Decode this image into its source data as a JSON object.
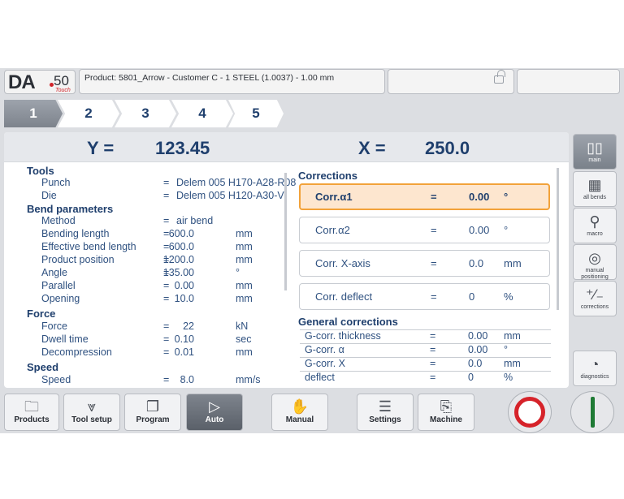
{
  "header": {
    "logo_da": "DA",
    "logo_model": "50",
    "logo_touch": "Touch",
    "product": "Product: 5801_Arrow - Customer C - 1 STEEL (1.0037) - 1.00 mm"
  },
  "steps": [
    "1",
    "2",
    "3",
    "4",
    "5"
  ],
  "axes": {
    "y_label": "Y =",
    "y_value": "123.45",
    "x_label": "X =",
    "x_value": "250.0"
  },
  "lines": [
    {
      "sec": "Tools"
    },
    {
      "label": "Punch",
      "eq": "=",
      "val": "Delem 005 H170-A28-R08"
    },
    {
      "label": "Die",
      "eq": "=",
      "val": "Delem 005 H120-A30-V"
    },
    {
      "sec": "Bend parameters"
    },
    {
      "label": "Method",
      "eq": "=",
      "val": "air bend"
    },
    {
      "label": "Bending length",
      "eq": "=",
      "val": "600.0",
      "unit": "mm"
    },
    {
      "label": "Effective bend length",
      "eq": "=",
      "val": "600.0",
      "unit": "mm"
    },
    {
      "label": "Product position",
      "eq": "=",
      "val": "1200.0",
      "unit": "mm"
    },
    {
      "label": "Angle",
      "eq": "=",
      "val": "135.00",
      "unit": "°"
    },
    {
      "label": "Parallel",
      "eq": "=",
      "val": "0.00",
      "unit": "mm"
    },
    {
      "label": "Opening",
      "eq": "=",
      "val": "10.0",
      "unit": "mm"
    },
    {
      "sec": "Force"
    },
    {
      "label": "Force",
      "eq": "=",
      "val": "22",
      "unit": "kN"
    },
    {
      "label": "Dwell time",
      "eq": "=",
      "val": "0.10",
      "unit": "sec"
    },
    {
      "label": "Decompression",
      "eq": "=",
      "val": "0.01",
      "unit": "mm"
    },
    {
      "sec": "Speed"
    },
    {
      "label": "Speed",
      "eq": "=",
      "val": "8.0",
      "unit": "mm/s"
    }
  ],
  "corrections": {
    "title": "Corrections",
    "items": [
      {
        "label": "Corr.α1",
        "eq": "=",
        "val": "0.00",
        "unit": "°"
      },
      {
        "label": "Corr.α2",
        "eq": "=",
        "val": "0.00",
        "unit": "°"
      },
      {
        "label": "Corr. X-axis",
        "eq": "=",
        "val": "0.0",
        "unit": "mm"
      },
      {
        "label": "Corr. deflect",
        "eq": "=",
        "val": "0",
        "unit": "%"
      }
    ]
  },
  "general": {
    "title": "General corrections",
    "items": [
      {
        "label": "G-corr. thickness",
        "eq": "=",
        "val": "0.00",
        "unit": "mm"
      },
      {
        "label": "G-corr. α",
        "eq": "=",
        "val": "0.00",
        "unit": "°"
      },
      {
        "label": "G-corr. X",
        "eq": "=",
        "val": "0.0",
        "unit": "mm"
      },
      {
        "label": "deflect",
        "eq": "=",
        "val": "0",
        "unit": "%"
      }
    ]
  },
  "side": {
    "main": "main",
    "all_bends": "all bends",
    "macro": "macro",
    "manual_positioning": "manual positioning",
    "corrections": "corrections",
    "diagnostics": "diagnostics"
  },
  "nav": {
    "products": "Products",
    "tool_setup": "Tool setup",
    "program": "Program",
    "auto": "Auto",
    "manual": "Manual",
    "settings": "Settings",
    "machine": "Machine"
  }
}
